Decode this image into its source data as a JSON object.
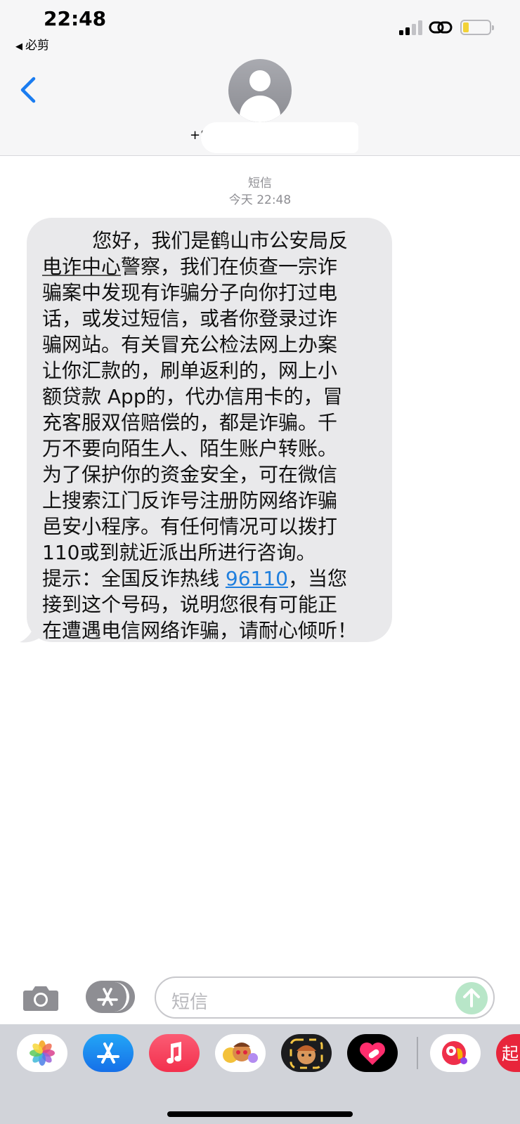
{
  "status_bar": {
    "time": "22:48",
    "back_app": "必剪"
  },
  "header": {
    "contact_visible": "+8"
  },
  "conversation": {
    "service_label": "短信",
    "timestamp": "今天 22:48",
    "message": {
      "before_underline": "        您好，我们是鹤山市公安局反\n",
      "underlined": "电诈中心",
      "middle": "警察，我们在侦查一宗诈\n骗案中发现有诈骗分子向你打过电\n话，或发过短信，或者你登录过诈\n骗网站。有关冒充公检法网上办案\n让你汇款的，刷单返利的，网上小\n额贷款 App的，代办信用卡的，冒\n充客服双倍赔偿的，都是诈骗。千\n万不要向陌生人、陌生账户转账。\n为了保护你的资金安全，可在微信\n上搜索江门反诈号注册防网络诈骗\n邑安小程序。有任何情况可以拨打\n110或到就近派出所进行咨询。\n提示：全国反诈热线 ",
      "link": "96110",
      "after_link": "，当您\n接到这个号码，说明您很有可能正\n在遭遇电信网络诈骗，请耐心倾听！"
    }
  },
  "input_bar": {
    "placeholder": "短信"
  },
  "app_tray": {
    "icons": [
      "photos-icon",
      "app-store-icon",
      "music-icon",
      "memoji-stickers-icon",
      "memoji-icon",
      "digital-touch-icon",
      "third-party-app-icon",
      "partial-app-icon"
    ]
  },
  "colors": {
    "accent": "#1a7cf0",
    "bubble": "#e9e9eb",
    "link": "#1f7fde"
  }
}
